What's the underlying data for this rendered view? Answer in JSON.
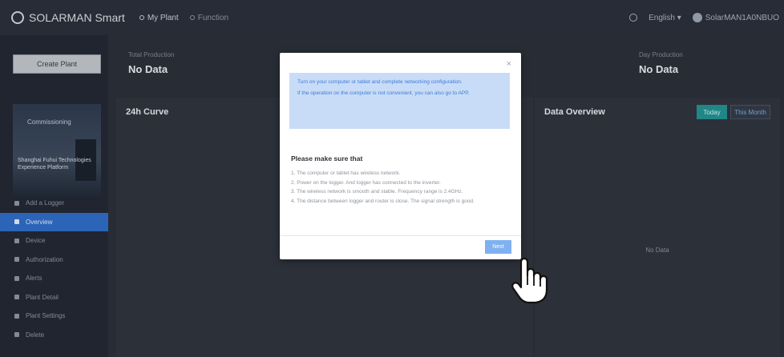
{
  "header": {
    "brand": "SOLARMAN Smart",
    "nav": [
      {
        "label": "My Plant",
        "active": true
      },
      {
        "label": "Function",
        "active": false
      }
    ],
    "language": "English",
    "user": "SolarMAN1A0NBUO"
  },
  "sidebar": {
    "create_button": "Create Plant",
    "plant": {
      "status": "Commissioning",
      "name": "Shanghai Fuhui Technologies Experience Platform"
    },
    "items": [
      {
        "label": "Add a Logger",
        "active": false
      },
      {
        "label": "Overview",
        "active": true
      },
      {
        "label": "Device",
        "active": false
      },
      {
        "label": "Authorization",
        "active": false
      },
      {
        "label": "Alerts",
        "active": false
      },
      {
        "label": "Plant Detail",
        "active": false
      },
      {
        "label": "Plant Settings",
        "active": false
      },
      {
        "label": "Delete",
        "active": false
      }
    ]
  },
  "stats": {
    "total_production_label": "Total Production",
    "total_production_value": "No Data",
    "daily_production_label": "Day Production",
    "daily_production_value": "No Data"
  },
  "curve_panel": {
    "title": "24h Curve"
  },
  "overview_panel": {
    "title": "Data Overview",
    "tab_today": "Today",
    "tab_month": "This Month",
    "no_data": "No Data"
  },
  "modal": {
    "close": "×",
    "info": [
      "Turn on your computer or tablet and complete networking configuration.",
      "If the operation on the computer is not convenient, you can also go to APP."
    ],
    "heading": "Please make sure that",
    "checklist": [
      "1. The computer or tablet has wireless network.",
      "2. Power on the logger. And logger has connected to the inverter.",
      "3. The wireless network is smooth and stable. Frequency range is 2.4GHz.",
      "4. The distance between logger and router is close. The signal strength is good."
    ],
    "next_button": "Next"
  },
  "colors": {
    "accent": "#2f6cc4",
    "teal": "#238f8f",
    "info_bg": "#c8dcf7",
    "info_text": "#3c7ad9",
    "next_button": "#7fb1f1"
  }
}
